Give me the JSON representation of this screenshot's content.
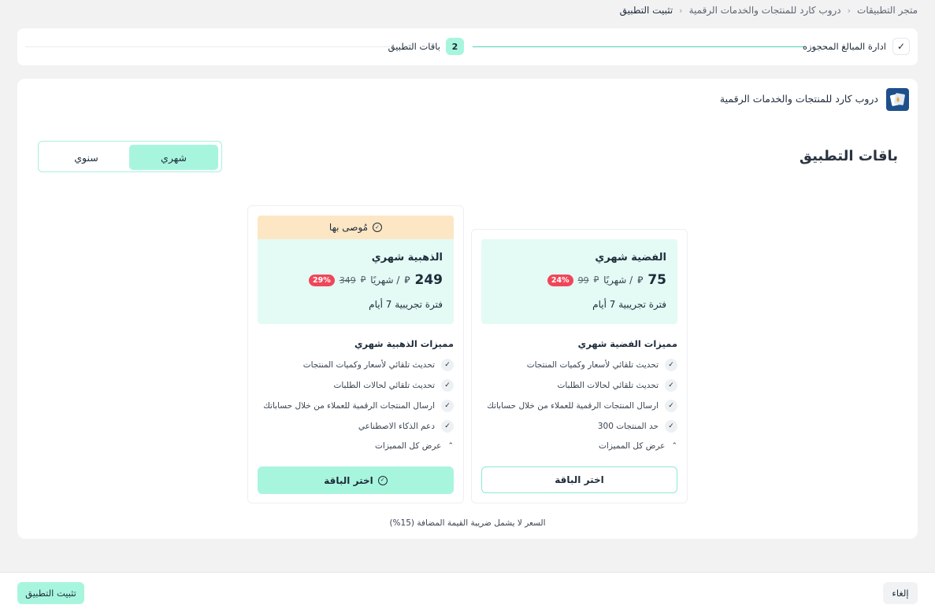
{
  "breadcrumb": {
    "items": [
      "متجر التطبيقات",
      "دروب كارد للمنتجات والخدمات الرقمية",
      "تثبيت التطبيق"
    ],
    "separator": "‹"
  },
  "stepper": {
    "step1_label": "ادارة المبالغ المحجوزه",
    "step2_number": "2",
    "step2_label": "باقات التطبيق"
  },
  "app": {
    "name": "دروب كارد للمنتجات والخدمات الرقمية",
    "logo_icon": "app-logo-icon"
  },
  "page_title": "باقات التطبيق",
  "billing_toggle": {
    "monthly": "شهري",
    "yearly": "سنوي",
    "selected": "monthly"
  },
  "plans": {
    "silver": {
      "name": "الفضية شهري",
      "price": "75",
      "per": "/ شهريًا",
      "old_price": "99",
      "discount": "24%",
      "trial": "فترة تجريبية 7 أيام",
      "features_title": "مميزات الفضية شهري",
      "features": [
        "تحديث تلقائي لأسعار وكميات المنتجات",
        "تحديث تلقائي لحالات الطلبات",
        "ارسال المنتجات الرقمية للعملاء من خلال حساباتك",
        "حد المنتجات 300"
      ],
      "show_all": "عرض كل المميزات",
      "select_button": "اختر الباقة"
    },
    "gold": {
      "recommended": "مُوصى بها",
      "name": "الذهبية شهري",
      "price": "249",
      "per": "/ شهريًا",
      "old_price": "349",
      "discount": "29%",
      "trial": "فترة تجريبية 7 أيام",
      "features_title": "مميزات الذهبية شهري",
      "features": [
        "تحديث تلقائي لأسعار وكميات المنتجات",
        "تحديث تلقائي لحالات الطلبات",
        "ارسال المنتجات الرقمية للعملاء من خلال حساباتك",
        "دعم الذكاء الاصطناعي"
      ],
      "show_all": "عرض كل المميزات",
      "select_button": "اختر الباقة"
    }
  },
  "currency_symbol": "⃁",
  "vat_note": "السعر لا يشمل ضريبة القيمة المضافة (15%)",
  "footer": {
    "cancel": "إلغاء",
    "install": "تثبيت التطبيق"
  },
  "colors": {
    "accent": "#a8f5de",
    "accent_line": "#4fd1b8",
    "card_head_bg": "#e3fbf4",
    "recommended_bg": "#fde6c4",
    "discount_badge": "#f0465a",
    "logo_bg": "#1d4f8a"
  }
}
